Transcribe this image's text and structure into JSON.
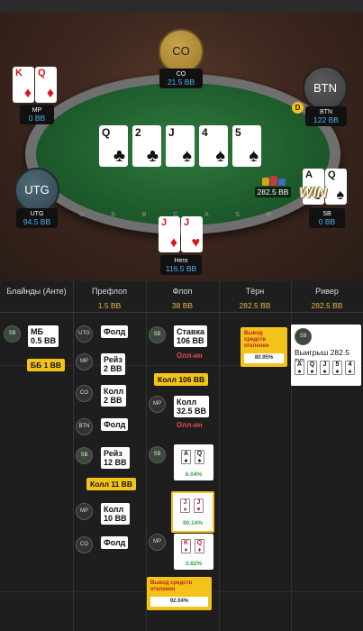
{
  "table": {
    "rail_text": "U S B   C A S H",
    "board": [
      {
        "rank": "Q",
        "suit": "♣",
        "color": "black"
      },
      {
        "rank": "2",
        "suit": "♣",
        "color": "black"
      },
      {
        "rank": "J",
        "suit": "♠",
        "color": "black"
      },
      {
        "rank": "4",
        "suit": "♠",
        "color": "black"
      },
      {
        "rank": "5",
        "suit": "♠",
        "color": "black"
      }
    ],
    "pot_display": "282.5 BB",
    "win_text": "WIN",
    "dealer_mark": "D",
    "seats": {
      "co": {
        "circle": "CO",
        "name": "CO",
        "stack": "21.5 BB"
      },
      "mp": {
        "name": "MP",
        "stack": "0 BB",
        "cards": [
          {
            "rank": "K",
            "suit": "♦"
          },
          {
            "rank": "Q",
            "suit": "♦"
          }
        ]
      },
      "btn": {
        "circle": "BTN",
        "name": "BTN",
        "stack": "122 BB"
      },
      "utg": {
        "circle": "UTG",
        "name": "UTG",
        "stack": "94.5 BB"
      },
      "sb": {
        "name": "SB",
        "stack": "0 BB",
        "cards": [
          {
            "rank": "A",
            "suit": "♠"
          },
          {
            "rank": "Q",
            "suit": "♠"
          }
        ]
      },
      "hero": {
        "name": "Hero",
        "stack": "116.5 BB",
        "cards": [
          {
            "rank": "J",
            "suit": "♦"
          },
          {
            "rank": "J",
            "suit": "♥"
          }
        ]
      }
    }
  },
  "history": {
    "columns": [
      {
        "name": "Блайнды (Анте)",
        "pot": ""
      },
      {
        "name": "Префлоп",
        "pot": "1.5 BB"
      },
      {
        "name": "Флоп",
        "pot": "38 BB"
      },
      {
        "name": "Тёрн",
        "pot": "282.5 BB"
      },
      {
        "name": "Ривер",
        "pot": "282.5 BB"
      }
    ],
    "blinds": {
      "sb_pos": "SB",
      "sb_action": "МБ\n0.5 BB",
      "bb_tag": "ББ 1 BB"
    },
    "preflop": [
      {
        "pos": "UTG",
        "action": "Фолд"
      },
      {
        "pos": "MP",
        "action": "Рейз\n2 BB"
      },
      {
        "pos": "CO",
        "action": "Колл\n2 BB"
      },
      {
        "pos": "BTN",
        "action": "Фолд"
      },
      {
        "pos": "SB",
        "action": "Рейз\n12 BB"
      },
      {
        "tag": "Колл 11 BB"
      },
      {
        "pos": "MP",
        "action": "Колл\n10 BB"
      },
      {
        "pos": "CO",
        "action": "Фолд"
      }
    ],
    "flop": {
      "sb_pos": "SB",
      "sb_action": "Ставка\n106 BB",
      "sb_allin": "Олл-ин",
      "hero_tag": "Колл 106 BB",
      "mp_pos": "MP",
      "mp_action": "Колл\n32.5 BB",
      "mp_allin": "Олл-ин",
      "eq_sb_pos": "SB",
      "eq_sb_pct": "6.04%",
      "eq_sb_cards": [
        {
          "rank": "A",
          "suit": "♠",
          "color": "black"
        },
        {
          "rank": "Q",
          "suit": "♠",
          "color": "black"
        }
      ],
      "eq_hero_pct": "90.14%",
      "eq_hero_cards": [
        {
          "rank": "J",
          "suit": "♦",
          "color": "red"
        },
        {
          "rank": "J",
          "suit": "♥",
          "color": "red"
        }
      ],
      "eq_mp_pos": "MP",
      "eq_mp_pct": "3.82%",
      "eq_mp_cards": [
        {
          "rank": "K",
          "suit": "♦",
          "color": "red"
        },
        {
          "rank": "Q",
          "suit": "♦",
          "color": "red"
        }
      ],
      "warn_text": "Вывод средств отклонен",
      "warn_pct": "92.04%"
    },
    "turn": {
      "warn_text": "Вывод средств отклонен",
      "warn_pct": "80.95%"
    },
    "river": {
      "pos": "SB",
      "win_text": "Выигрыш 282.5 BB",
      "cards": [
        {
          "rank": "A",
          "suit": "♠",
          "color": "black"
        },
        {
          "rank": "Q",
          "suit": "♠",
          "color": "black"
        },
        {
          "rank": "J",
          "suit": "♠",
          "color": "black"
        },
        {
          "rank": "5",
          "suit": "♠",
          "color": "black"
        },
        {
          "rank": "4",
          "suit": "♠",
          "color": "black"
        }
      ]
    }
  },
  "colors": {
    "accent": "#f2c318",
    "stack_blue": "#4fb3e8",
    "felt": "#1f5e2d",
    "allin_red": "#e24a4a",
    "equity_green": "#3aa64a"
  }
}
